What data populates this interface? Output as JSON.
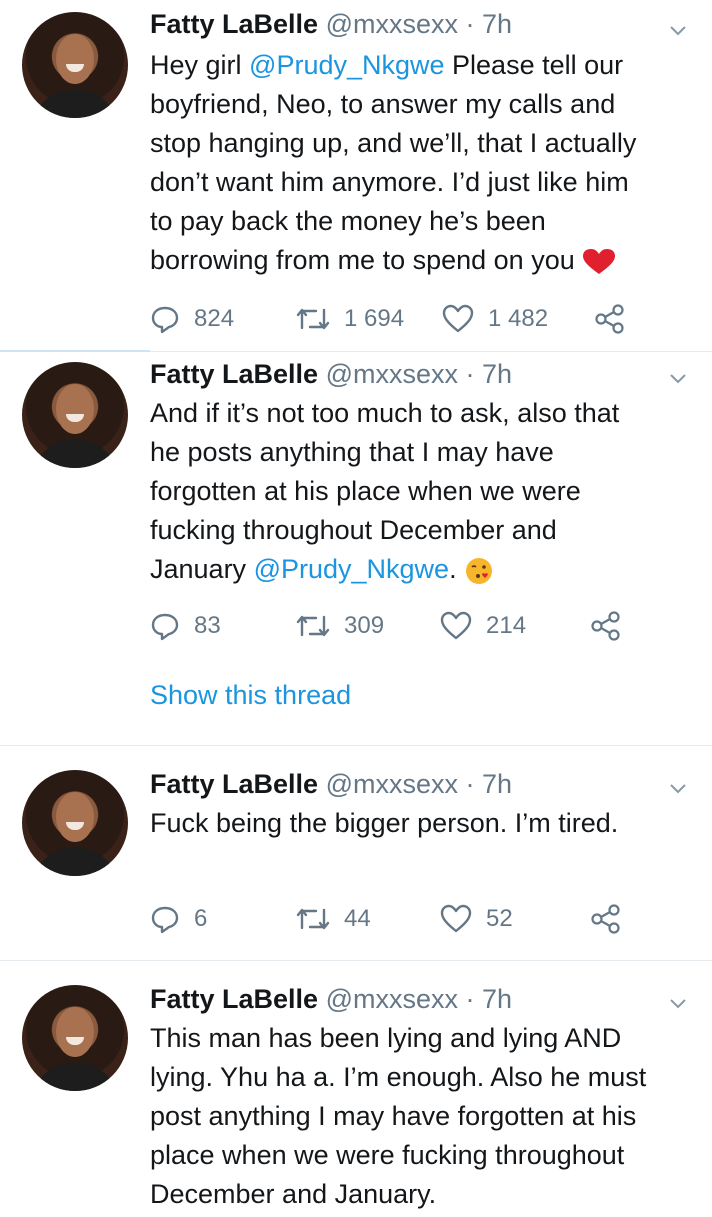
{
  "tweets": [
    {
      "name": "Fatty LaBelle",
      "handle": "@mxxsexx",
      "dot": "·",
      "time": "7h",
      "text_lines": [
        [
          "Hey girl ",
          "@Prudy_Nkgwe",
          " Please tell our"
        ],
        [
          "boyfriend, Neo, to answer my calls and"
        ],
        [
          "stop hanging up, and we’ll, that I actually"
        ],
        [
          "don’t want him anymore. I’d just like him"
        ],
        [
          "to pay back the money he’s been"
        ],
        [
          "borrowing from me to spend on you "
        ]
      ],
      "replies": "824",
      "retweets": "1 694",
      "likes": "1 482"
    },
    {
      "name": "Fatty LaBelle",
      "handle": "@mxxsexx",
      "dot": "·",
      "time": "7h",
      "text_lines": [
        [
          "And if it’s not too much to ask, also that"
        ],
        [
          "he posts anything that I may have"
        ],
        [
          "forgotten at his place when we were"
        ],
        [
          "fucking throughout December and"
        ],
        [
          "January ",
          "@Prudy_Nkgwe",
          ". "
        ]
      ],
      "replies": "83",
      "retweets": "309",
      "likes": "214",
      "show_thread": "Show this thread"
    },
    {
      "name": "Fatty LaBelle",
      "handle": "@mxxsexx",
      "dot": "·",
      "time": "7h",
      "text_lines": [
        [
          "Fuck being the bigger person. I’m tired."
        ]
      ],
      "replies": "6",
      "retweets": "44",
      "likes": "52"
    },
    {
      "name": "Fatty LaBelle",
      "handle": "@mxxsexx",
      "dot": "·",
      "time": "7h",
      "text_lines": [
        [
          "This man has been lying and lying AND"
        ],
        [
          "lying. Yhu ha a. I’m enough. Also he must"
        ],
        [
          "post anything I may have forgotten at his"
        ],
        [
          "place when we were fucking throughout"
        ],
        [
          "December and January."
        ]
      ]
    }
  ],
  "icons": {
    "reply": "reply-icon",
    "retweet": "retweet-icon",
    "like": "like-icon",
    "share": "share-icon",
    "caret": "chevron-down-icon",
    "heart_emoji": "red-heart-emoji",
    "kiss_emoji": "face-blowing-kiss-emoji"
  },
  "colors": {
    "link": "#1b95e0",
    "muted": "#657786",
    "text": "#14171a"
  }
}
